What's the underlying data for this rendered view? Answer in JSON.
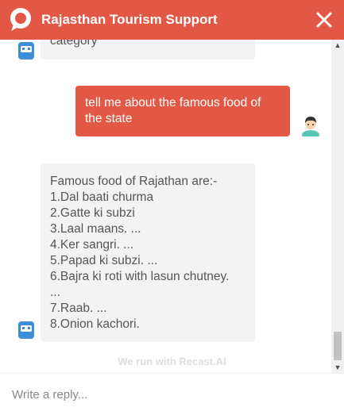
{
  "header": {
    "title": "Rajasthan Tourism Support",
    "brand_color": "#e35845",
    "logo_icon": "chat-bubble-icon",
    "close_icon": "close-icon"
  },
  "messages": [
    {
      "from": "bot",
      "text": "category"
    },
    {
      "from": "user",
      "lines": [
        "tell me about the famous food of",
        "the state"
      ]
    },
    {
      "from": "bot",
      "lines": [
        "Famous food of Rajathan are:-",
        "1.Dal baati churma",
        "2.Gatte ki subzi",
        "3.Laal maans. ...",
        "4.Ker sangri. ...",
        "5.Papad ki subzi. ...",
        "6.Bajra ki roti with lasun chutney.",
        "...",
        "7.Raab. ...",
        "8.Onion kachori."
      ]
    }
  ],
  "powered_by": "We run with Recast.AI",
  "composer": {
    "placeholder": "Write a reply..."
  }
}
